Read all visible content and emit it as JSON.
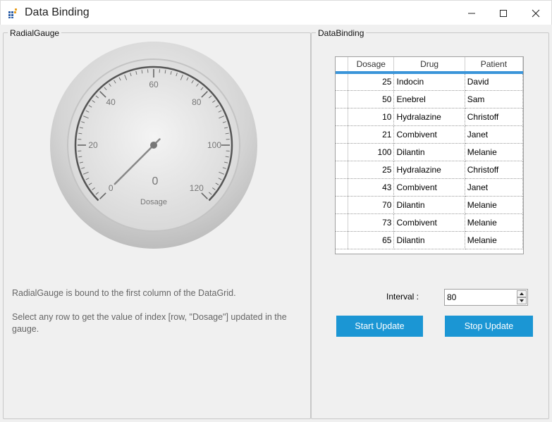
{
  "window": {
    "title": "Data Binding"
  },
  "gauge_panel": {
    "legend": "RadialGauge",
    "gauge": {
      "value": 0,
      "value_text": "0",
      "label": "Dosage",
      "min": 0,
      "max": 120,
      "tick_labels": [
        "0",
        "20",
        "40",
        "60",
        "80",
        "100",
        "120"
      ]
    },
    "info1": "RadialGauge is bound to the first column of the DataGrid.",
    "info2": "Select any row to get the value of index [row, \"Dosage\"] updated in the gauge."
  },
  "binding_panel": {
    "legend": "DataBinding",
    "columns": [
      "Dosage",
      "Drug",
      "Patient"
    ],
    "rows": [
      [
        "25",
        "Indocin",
        "David"
      ],
      [
        "50",
        "Enebrel",
        "Sam"
      ],
      [
        "10",
        "Hydralazine",
        "Christoff"
      ],
      [
        "21",
        "Combivent",
        "Janet"
      ],
      [
        "100",
        "Dilantin",
        "Melanie"
      ],
      [
        "25",
        "Hydralazine",
        "Christoff"
      ],
      [
        "43",
        "Combivent",
        "Janet"
      ],
      [
        "70",
        "Dilantin",
        "Melanie"
      ],
      [
        "73",
        "Combivent",
        "Melanie"
      ],
      [
        "65",
        "Dilantin",
        "Melanie"
      ]
    ],
    "interval_label": "Interval :",
    "interval_value": "80",
    "start_label": "Start Update",
    "stop_label": "Stop Update"
  },
  "colors": {
    "accent": "#1b96d4",
    "grid_header_line": "#3b95d9"
  }
}
